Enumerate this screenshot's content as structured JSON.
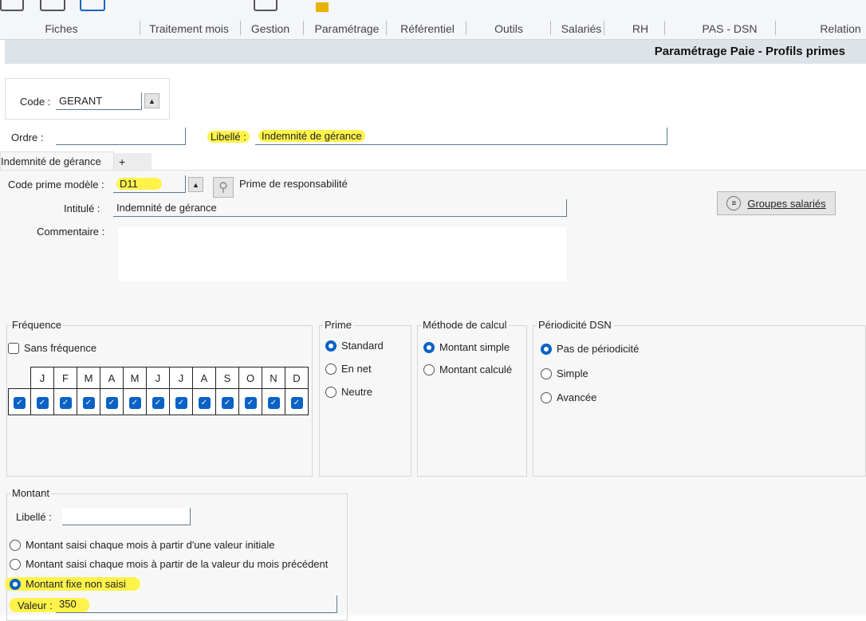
{
  "toolbar": {
    "groups": [
      "Fiches",
      "Traitement mois",
      "Gestion",
      "Paramétrage",
      "Référentiel",
      "Outils",
      "Salariés",
      "RH",
      "PAS - DSN",
      "Relation"
    ]
  },
  "header": {
    "title": "Paramétrage Paie - Profils primes"
  },
  "form": {
    "code_label": "Code :",
    "code_value": "GERANT",
    "ordre_label": "Ordre :",
    "ordre_value": "",
    "libelle_label": "Libellé :",
    "libelle_value": "Indemnité de gérance",
    "tabs": [
      "Indemnité de gérance",
      "+"
    ],
    "code_prime_label": "Code prime modèle :",
    "code_prime_value": "D11",
    "code_prime_desc": "Prime de responsabilité",
    "intitule_label": "Intitulé :",
    "intitule_value": "Indemnité de gérance",
    "commentaire_label": "Commentaire :",
    "commentaire_value": "",
    "groupes_button": "Groupes salariés"
  },
  "frequence": {
    "legend": "Fréquence",
    "sans_label": "Sans fréquence",
    "sans_checked": false,
    "months": [
      "J",
      "F",
      "M",
      "A",
      "M",
      "J",
      "J",
      "A",
      "S",
      "O",
      "N",
      "D"
    ],
    "checked": [
      true,
      true,
      true,
      true,
      true,
      true,
      true,
      true,
      true,
      true,
      true,
      true
    ]
  },
  "prime": {
    "legend": "Prime",
    "options": [
      "Standard",
      "En net",
      "Neutre"
    ],
    "selected": 0
  },
  "methode": {
    "legend": "Méthode de calcul",
    "options": [
      "Montant simple",
      "Montant calculé"
    ],
    "selected": 0
  },
  "periodicite": {
    "legend": "Périodicité DSN",
    "options": [
      "Pas de périodicité",
      "Simple",
      "Avancée"
    ],
    "selected": 0
  },
  "montant": {
    "legend": "Montant",
    "libelle_label": "Libellé :",
    "libelle_value": "",
    "options": [
      "Montant saisi chaque mois à partir d'une valeur initiale",
      "Montant saisi chaque mois à partir de la valeur du mois précédent",
      "Montant fixe non saisi"
    ],
    "selected": 2,
    "valeur_label": "Valeur :",
    "valeur_value": "350"
  },
  "colors": {
    "accent": "#0a62c4",
    "highlight": "#fff34a"
  }
}
